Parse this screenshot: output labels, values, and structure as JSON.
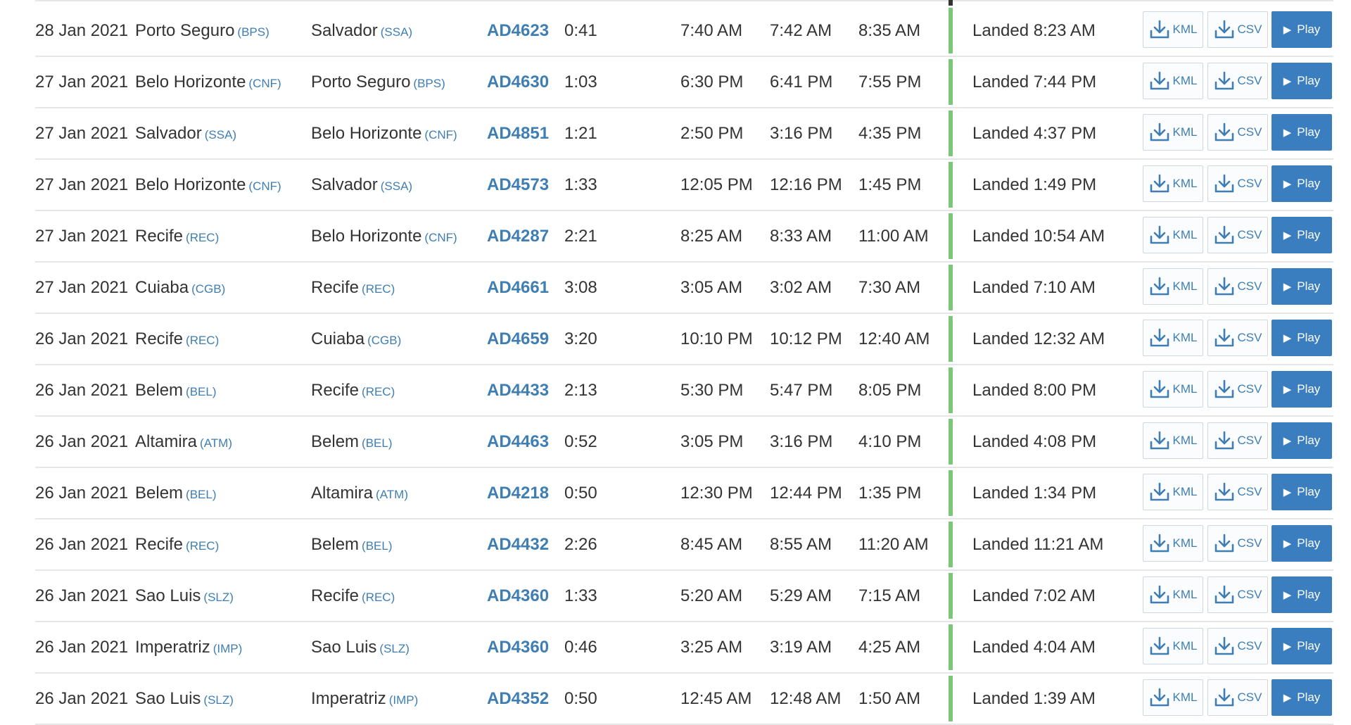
{
  "buttons": {
    "kml_label": "KML",
    "csv_label": "CSV",
    "play_label": "Play"
  },
  "colors": {
    "link_blue": "#3e7eb3",
    "play_button": "#3a7ebf",
    "status_landed": "#7cc67c",
    "row_divider": "#e6e6e6"
  },
  "flights": [
    {
      "date": "28 Jan 2021",
      "from_city": "Porto Seguro",
      "from_code": "(BPS)",
      "to_city": "Salvador",
      "to_code": "(SSA)",
      "flight": "AD4623",
      "duration": "0:41",
      "scheduled": "7:40 AM",
      "departed": "7:42 AM",
      "arrival": "8:35 AM",
      "status": "Landed 8:23 AM"
    },
    {
      "date": "27 Jan 2021",
      "from_city": "Belo Horizonte",
      "from_code": "(CNF)",
      "to_city": "Porto Seguro",
      "to_code": "(BPS)",
      "flight": "AD4630",
      "duration": "1:03",
      "scheduled": "6:30 PM",
      "departed": "6:41 PM",
      "arrival": "7:55 PM",
      "status": "Landed 7:44 PM"
    },
    {
      "date": "27 Jan 2021",
      "from_city": "Salvador",
      "from_code": "(SSA)",
      "to_city": "Belo Horizonte",
      "to_code": "(CNF)",
      "flight": "AD4851",
      "duration": "1:21",
      "scheduled": "2:50 PM",
      "departed": "3:16 PM",
      "arrival": "4:35 PM",
      "status": "Landed 4:37 PM"
    },
    {
      "date": "27 Jan 2021",
      "from_city": "Belo Horizonte",
      "from_code": "(CNF)",
      "to_city": "Salvador",
      "to_code": "(SSA)",
      "flight": "AD4573",
      "duration": "1:33",
      "scheduled": "12:05 PM",
      "departed": "12:16 PM",
      "arrival": "1:45 PM",
      "status": "Landed 1:49 PM"
    },
    {
      "date": "27 Jan 2021",
      "from_city": "Recife",
      "from_code": "(REC)",
      "to_city": "Belo Horizonte",
      "to_code": "(CNF)",
      "flight": "AD4287",
      "duration": "2:21",
      "scheduled": "8:25 AM",
      "departed": "8:33 AM",
      "arrival": "11:00 AM",
      "status": "Landed 10:54 AM"
    },
    {
      "date": "27 Jan 2021",
      "from_city": "Cuiaba",
      "from_code": "(CGB)",
      "to_city": "Recife",
      "to_code": "(REC)",
      "flight": "AD4661",
      "duration": "3:08",
      "scheduled": "3:05 AM",
      "departed": "3:02 AM",
      "arrival": "7:30 AM",
      "status": "Landed 7:10 AM"
    },
    {
      "date": "26 Jan 2021",
      "from_city": "Recife",
      "from_code": "(REC)",
      "to_city": "Cuiaba",
      "to_code": "(CGB)",
      "flight": "AD4659",
      "duration": "3:20",
      "scheduled": "10:10 PM",
      "departed": "10:12 PM",
      "arrival": "12:40 AM",
      "status": "Landed 12:32 AM"
    },
    {
      "date": "26 Jan 2021",
      "from_city": "Belem",
      "from_code": "(BEL)",
      "to_city": "Recife",
      "to_code": "(REC)",
      "flight": "AD4433",
      "duration": "2:13",
      "scheduled": "5:30 PM",
      "departed": "5:47 PM",
      "arrival": "8:05 PM",
      "status": "Landed 8:00 PM"
    },
    {
      "date": "26 Jan 2021",
      "from_city": "Altamira",
      "from_code": "(ATM)",
      "to_city": "Belem",
      "to_code": "(BEL)",
      "flight": "AD4463",
      "duration": "0:52",
      "scheduled": "3:05 PM",
      "departed": "3:16 PM",
      "arrival": "4:10 PM",
      "status": "Landed 4:08 PM"
    },
    {
      "date": "26 Jan 2021",
      "from_city": "Belem",
      "from_code": "(BEL)",
      "to_city": "Altamira",
      "to_code": "(ATM)",
      "flight": "AD4218",
      "duration": "0:50",
      "scheduled": "12:30 PM",
      "departed": "12:44 PM",
      "arrival": "1:35 PM",
      "status": "Landed 1:34 PM"
    },
    {
      "date": "26 Jan 2021",
      "from_city": "Recife",
      "from_code": "(REC)",
      "to_city": "Belem",
      "to_code": "(BEL)",
      "flight": "AD4432",
      "duration": "2:26",
      "scheduled": "8:45 AM",
      "departed": "8:55 AM",
      "arrival": "11:20 AM",
      "status": "Landed 11:21 AM"
    },
    {
      "date": "26 Jan 2021",
      "from_city": "Sao Luis",
      "from_code": "(SLZ)",
      "to_city": "Recife",
      "to_code": "(REC)",
      "flight": "AD4360",
      "duration": "1:33",
      "scheduled": "5:20 AM",
      "departed": "5:29 AM",
      "arrival": "7:15 AM",
      "status": "Landed 7:02 AM"
    },
    {
      "date": "26 Jan 2021",
      "from_city": "Imperatriz",
      "from_code": "(IMP)",
      "to_city": "Sao Luis",
      "to_code": "(SLZ)",
      "flight": "AD4360",
      "duration": "0:46",
      "scheduled": "3:25 AM",
      "departed": "3:19 AM",
      "arrival": "4:25 AM",
      "status": "Landed 4:04 AM"
    },
    {
      "date": "26 Jan 2021",
      "from_city": "Sao Luis",
      "from_code": "(SLZ)",
      "to_city": "Imperatriz",
      "to_code": "(IMP)",
      "flight": "AD4352",
      "duration": "0:50",
      "scheduled": "12:45 AM",
      "departed": "12:48 AM",
      "arrival": "1:50 AM",
      "status": "Landed 1:39 AM"
    }
  ]
}
